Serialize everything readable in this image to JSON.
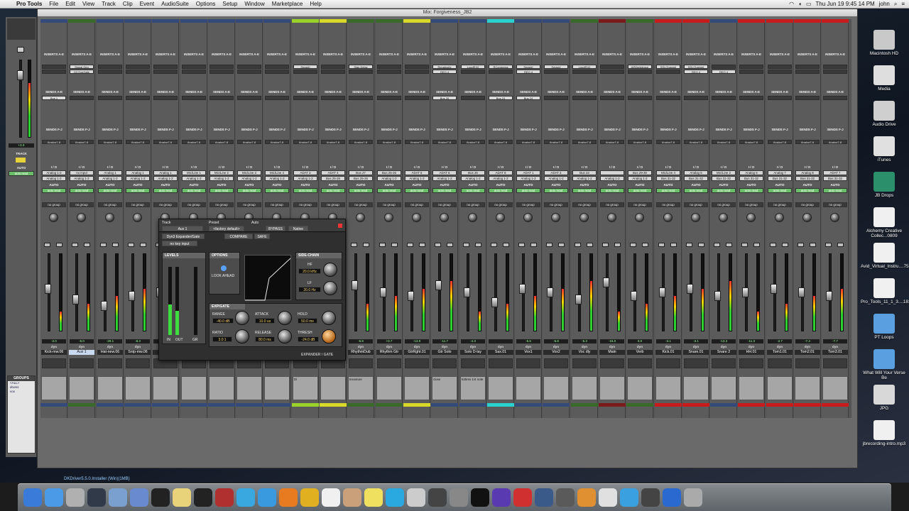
{
  "menubar": {
    "items": [
      "Pro Tools",
      "File",
      "Edit",
      "View",
      "Track",
      "Clip",
      "Event",
      "AudioSuite",
      "Options",
      "Setup",
      "Window",
      "Marketplace",
      "Help"
    ],
    "clock": "Thu Jun 19  9:45 14 PM",
    "user": "john"
  },
  "window": {
    "title": "Mix: Forgiveness_JB2"
  },
  "strips": [
    {
      "name": "Kick-mw.06",
      "io_in": "Analog 1-2",
      "io_out": "Analog 1-2",
      "vol": "-2.0",
      "volr": "-2.0",
      "color": "#334a7a",
      "send": "Bus 1",
      "cmt": ""
    },
    {
      "name": "Aux 1",
      "io_in": "no input",
      "io_out": "Analog 1-2",
      "vol": "-5.0",
      "volr": "-5.0",
      "color": "#3a6a2a",
      "ins1": "Signal Gen",
      "ins2": "D3 ExpGate",
      "cmt": "",
      "sel": true
    },
    {
      "name": "Hat-new.06",
      "io_in": "Analog 1",
      "io_out": "Analog 1-2",
      "vol": "-29.1",
      "volr": "-28.1",
      "color": "#334a7a",
      "cmt": ""
    },
    {
      "name": "Sntp-mw.06",
      "io_in": "Analog 1",
      "io_out": "Analog 1-2",
      "vol": "-8.3",
      "volr": "-8.9",
      "color": "#334a7a",
      "cmt": ""
    },
    {
      "name": "",
      "io_in": "Analog 1",
      "io_out": "Analog 1-2",
      "vol": "",
      "volr": "",
      "color": "#334a7a",
      "cmt": ""
    },
    {
      "name": "",
      "io_in": "Mic/Line 1",
      "io_out": "Analog 1-2",
      "vol": "",
      "volr": "",
      "color": "#334a7a",
      "cmt": ""
    },
    {
      "name": "",
      "io_in": "Mic/Line 2",
      "io_out": "Analog 1-2",
      "vol": "",
      "volr": "",
      "color": "#334a7a",
      "cmt": ""
    },
    {
      "name": "",
      "io_in": "Mic/Line 3",
      "io_out": "Analog 1-2",
      "vol": "",
      "volr": "",
      "color": "#334a7a",
      "cmt": ""
    },
    {
      "name": "",
      "io_in": "Mic/Line 4",
      "io_out": "Analog 1-2",
      "vol": "",
      "volr": "",
      "color": "#334a7a",
      "cmt": ""
    },
    {
      "name": "",
      "io_in": "ADAT 3",
      "io_out": "Analog 1-2",
      "vol": "",
      "volr": "",
      "color": "#9ad12a",
      "ins1": "Smack!",
      "cmt": "Di"
    },
    {
      "name": "",
      "io_in": "ADAT 4",
      "io_out": "Bus 25-26",
      "vol": "",
      "volr": "",
      "color": "#d9d92a",
      "cmt": ""
    },
    {
      "name": "RhythmDub",
      "io_in": "Bus 27",
      "io_out": "Bus 25-26",
      "vol": "-6.8",
      "volr": "",
      "color": "#3a6a2a",
      "ins1": "Slap Delay",
      "cmt": "texxxture"
    },
    {
      "name": "Rhythm Gtr",
      "io_in": "Bus 25-26",
      "io_out": "Analog 1-2",
      "vol": "+0.7",
      "volr": "-13.9",
      "color": "#3a6a2a",
      "cmt": ""
    },
    {
      "name": "GtrRght.01",
      "io_in": "ADAT 5",
      "io_out": "Analog 1-2",
      "vol": "-13.9",
      "volr": "-15.9",
      "color": "#d9d92a",
      "cmt": ""
    },
    {
      "name": "Gtr Solo",
      "io_in": "ADAT 6",
      "io_out": "Analog 1-2",
      "vol": "-11.7",
      "volr": "",
      "color": "#334a7a",
      "ins1": "RenaissAx",
      "ins2": "REQ 4",
      "send": "Bus 26",
      "cmt": "close"
    },
    {
      "name": "Solo D-lay",
      "io_in": "Bus 26",
      "io_out": "Analog 1-2",
      "vol": "-4.3",
      "volr": "",
      "color": "#334a7a",
      "ins1": "LoudRX2",
      "cmt": "525ms 1/4 note"
    },
    {
      "name": "Sax.01",
      "io_in": "ADAT 8",
      "io_out": "Analog 1-2",
      "vol": "",
      "volr": "",
      "color": "#2ad1d1",
      "ins1": "RCompress",
      "send": "Bus 24",
      "cmt": ""
    },
    {
      "name": "Vox1",
      "io_in": "ADAT 1",
      "io_out": "Analog 1-2",
      "vol": "-5.5",
      "volr": "",
      "color": "#334a7a",
      "ins1": "Smack!",
      "ins2": "REQ 4",
      "send": "Bus 24",
      "cmt": ""
    },
    {
      "name": "Vox2",
      "io_in": "ADAT 2",
      "io_out": "Analog 1-2",
      "vol": "-6.8",
      "volr": "",
      "color": "#334a7a",
      "ins1": "Smack!",
      "cmt": ""
    },
    {
      "name": "Voc dly",
      "io_in": "Bus 24",
      "io_out": "Analog 1-2",
      "vol": "-5.3",
      "volr": "",
      "color": "#3a6a2a",
      "ins1": "LoudRX2",
      "cmt": ""
    },
    {
      "name": "Main",
      "io_in": "",
      "io_out": "Analog 1-2",
      "vol": "-15.0",
      "volr": "-0.0",
      "color": "#7a1a1a",
      "cmt": ""
    },
    {
      "name": "Verb",
      "io_in": "Bus 29-30",
      "io_out": "Analog 1-2",
      "vol": "0.0",
      "volr": "",
      "color": "#3a6a2a",
      "ins1": "AIRAmbience",
      "cmt": ""
    },
    {
      "name": "Kick.01",
      "io_in": "Mic/Line 4",
      "io_out": "Bus 31-32",
      "vol": "-3.1",
      "volr": "",
      "color": "#c81c1c",
      "ins1": "SSLChannel",
      "cmt": ""
    },
    {
      "name": "Snare.01",
      "io_in": "Analog 5",
      "io_out": "Bus 31-32",
      "vol": "-3.1",
      "volr": "",
      "color": "#c81c1c",
      "ins1": "SSLChannel",
      "ins2": "REQ 4",
      "cmt": ""
    },
    {
      "name": "Snare 2",
      "io_in": "Mic/Line 2",
      "io_out": "Bus 31-32",
      "vol": "-13.3",
      "volr": "",
      "color": "#334a7a",
      "ins2": "REQ 4",
      "cmt": ""
    },
    {
      "name": "HH.01",
      "io_in": "Analog 6",
      "io_out": "Bus 31-32",
      "vol": "-11.3",
      "volr": "",
      "color": "#c81c1c",
      "cmt": ""
    },
    {
      "name": "Tom1.01",
      "io_in": "Analog 7",
      "io_out": "Bus 31-32",
      "vol": "-2.7",
      "volr": "",
      "color": "#c81c1c",
      "cmt": ""
    },
    {
      "name": "Tom2.01",
      "io_in": "Analog 8",
      "io_out": "Bus 31-32",
      "vol": "-7.4",
      "volr": "",
      "color": "#c81c1c",
      "cmt": ""
    },
    {
      "name": "Tom3.01",
      "io_in": "ADAT 7",
      "io_out": "Bus 31-32",
      "vol": "-7.7",
      "volr": "",
      "color": "#c81c1c",
      "cmt": ""
    }
  ],
  "labels": {
    "inserts_ae": "INSERTS A-E",
    "inserts_fj": "INSERTS F-J",
    "sends_ae": "SENDS A-E",
    "sends_fj": "SENDS F-J",
    "io": "I / O",
    "auto": "AUTO",
    "auto_read": "auto read",
    "group": "no group",
    "send_default": "Analog7-8",
    "dyn": "dyn"
  },
  "left_panel": {
    "track": "TRACK",
    "auto": "AUTO",
    "auto_read": "auto read",
    "vol": "+3.3",
    "groups_title": "GROUPS",
    "groups": [
      "<ALL>",
      "drums",
      "vox"
    ]
  },
  "plugin": {
    "track_label": "Track",
    "preset_label": "Preset",
    "auto_label": "Auto",
    "track": "Aux 1",
    "plugin_name": "Dyn3 Expander/Gate",
    "preset": "<factory default>",
    "compare": "COMPARE",
    "bypass": "BYPASS",
    "safe": "SAFE",
    "native": "Native",
    "key_input": "no key input",
    "levels": "LEVELS",
    "options": "OPTIONS",
    "look_ahead": "LOOK AHEAD",
    "sidechain": "SIDE-CHAIN",
    "hf_label": "HF",
    "lf_label": "LF",
    "hf": "20.0 kHz",
    "lf": "20.0 Hz",
    "expgate": "EXP/GATE",
    "range_label": "RANGE",
    "range": "-40.0 dB",
    "attack_label": "ATTACK",
    "attack": "10.0 us",
    "hold_label": "HOLD",
    "hold": "50.0 ms",
    "ratio_label": "RATIO",
    "ratio": "3.0:1",
    "release_label": "RELEASE",
    "release": "80.0 ms",
    "thresh_label": "THRESH",
    "thresh": "-24.0 dB",
    "meter_in": "IN",
    "meter_out": "OUT",
    "meter_gr": "GR",
    "brand": "EXPANDER / GATE"
  },
  "desktop": {
    "icons": [
      "Macintosh HD",
      "Media",
      "Audio Drive",
      "iTunes",
      "JB Drops",
      "Alchemy Creative Collec...0809",
      "Avid_Virtual_Instru....7520",
      "Pro_Tools_11_1_3....1812",
      "PT Loops",
      "What Will Your Verse Be",
      "JPG",
      "jbrecording-intro.mp3"
    ]
  },
  "dock": {
    "apps": [
      "Finder",
      "Safari",
      "Launchpad",
      "Mission Control",
      "Preview",
      "Mail",
      "Quicktime",
      "Notes",
      "Pro Tools",
      "Photo Booth",
      "Messages",
      "Safari2",
      "Firefox",
      "Chrome",
      "Calendar",
      "Contacts",
      "Stickies",
      "iTunes",
      "Image Capture",
      "Final Cut",
      "Logic",
      "iLok",
      "Avid",
      "Toolbox",
      "iPhoto",
      "Utilities",
      "Hype",
      "JBL",
      "Waves",
      "Tools",
      "Compressor",
      "Trash"
    ]
  },
  "status": {
    "taskline": "DKDriver5.5.0.Installer (Win)(1MB)"
  }
}
